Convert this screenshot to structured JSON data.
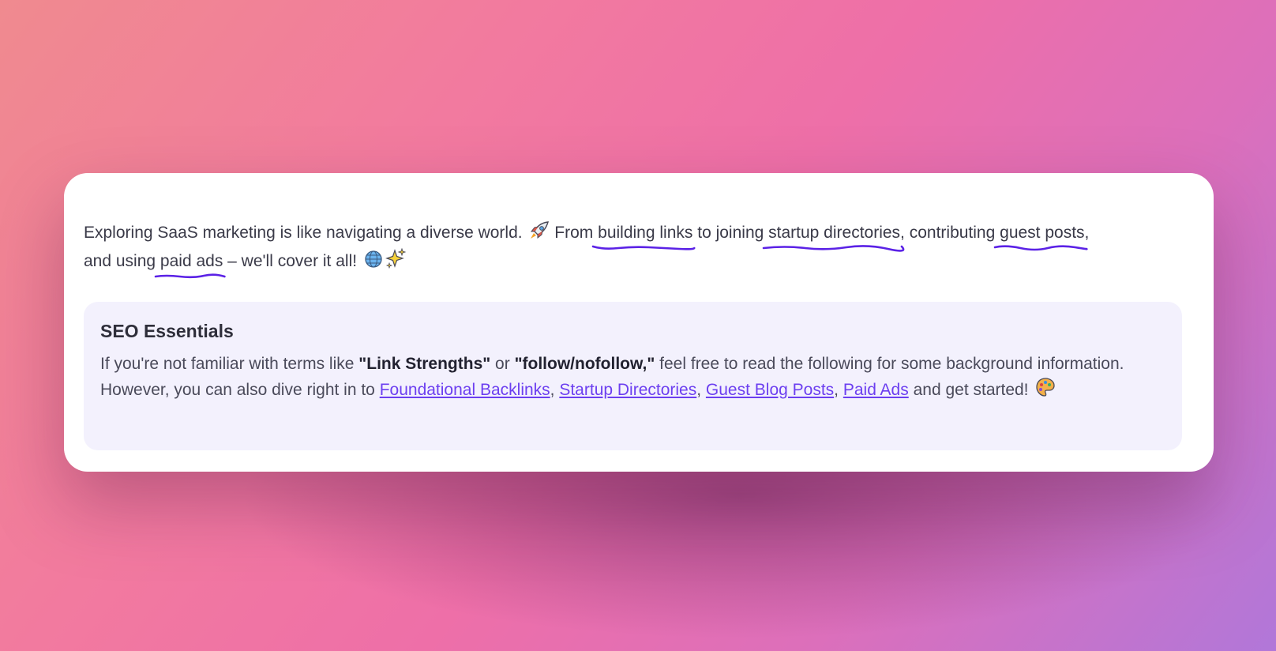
{
  "intro": {
    "part1": "Exploring SaaS marketing is like navigating a diverse world.",
    "part2": "From",
    "link1": "building links",
    "part3": "to joining",
    "link2": "startup directories",
    "part4": ", contributing",
    "link3": "guest posts",
    "part5": ", and using",
    "link4": "paid ads",
    "part6": "– we'll cover it all!"
  },
  "callout": {
    "title": "SEO Essentials",
    "text1": "If you're not familiar with terms like ",
    "bold1": "\"Link Strengths\"",
    "text2": " or ",
    "bold2": "\"follow/nofollow,\"",
    "text3": " feel free to read the following for some background information. However, you can also dive right in to ",
    "links": [
      "Foundational Backlinks",
      "Startup Directories",
      "Guest Blog Posts",
      "Paid Ads"
    ],
    "sep": ", ",
    "text4": " and get started!"
  },
  "colors": {
    "squiggle": "#5b22e6",
    "link": "#6c3ff0",
    "callout_bg": "#f3f1fd"
  },
  "icons": [
    "rocket-icon",
    "globe-icon",
    "sparkles-icon",
    "palette-icon"
  ]
}
